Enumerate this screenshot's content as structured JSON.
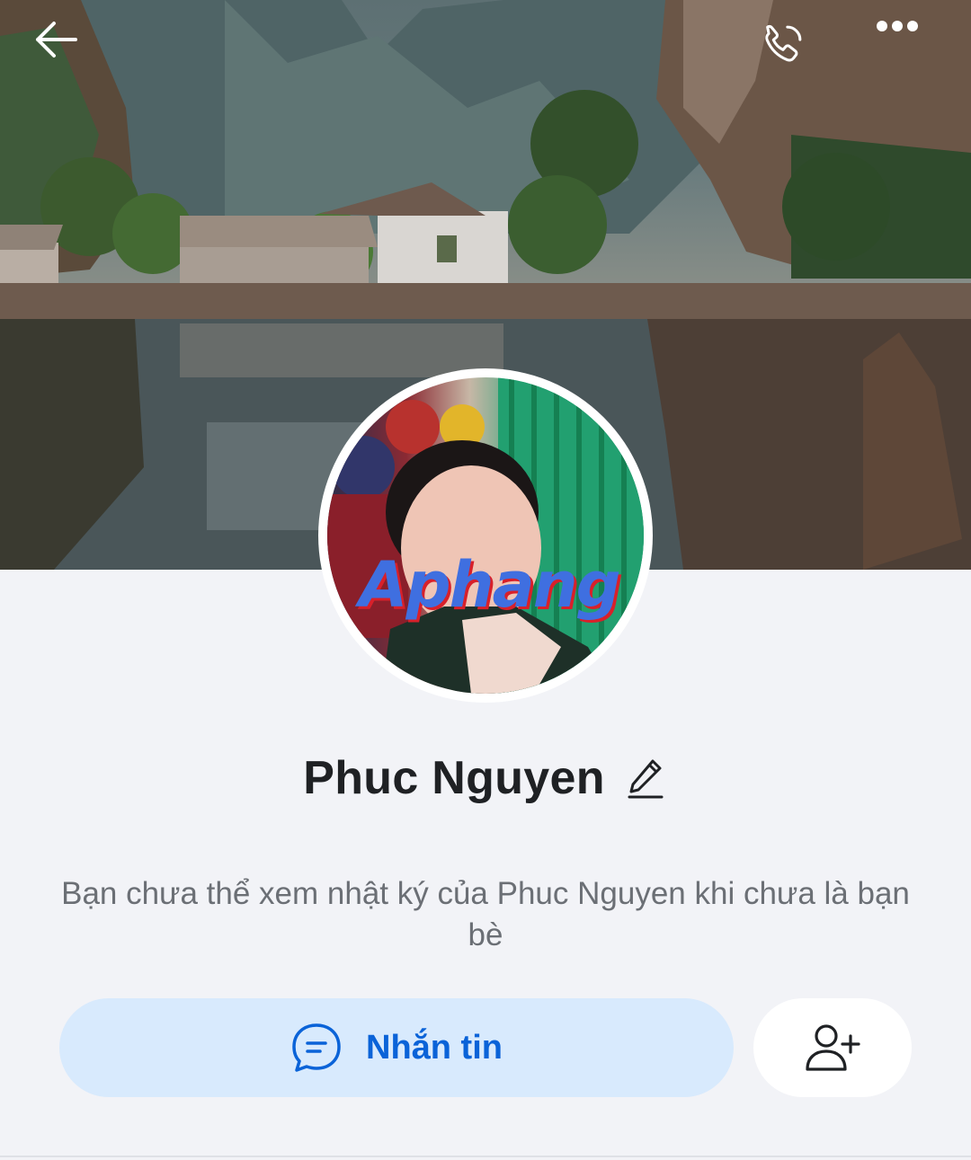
{
  "header": {
    "back_icon": "arrow-left-icon",
    "call_icon": "phone-icon",
    "more_icon": "more-horizontal-icon"
  },
  "profile": {
    "name": "Phuc Nguyen",
    "edit_icon": "pencil-icon",
    "avatar_watermark": "Aphang"
  },
  "info": {
    "message": "Bạn chưa thể xem nhật ký của Phuc Nguyen khi chưa là bạn bè"
  },
  "actions": {
    "message_label": "Nhắn tin",
    "message_icon": "chat-bubble-icon",
    "add_friend_icon": "add-user-icon"
  },
  "colors": {
    "accent": "#0a63d8",
    "message_button_bg": "#d8eafd",
    "page_bg": "#f2f3f7",
    "text_primary": "#1f2124",
    "text_secondary": "#6b6f75"
  }
}
